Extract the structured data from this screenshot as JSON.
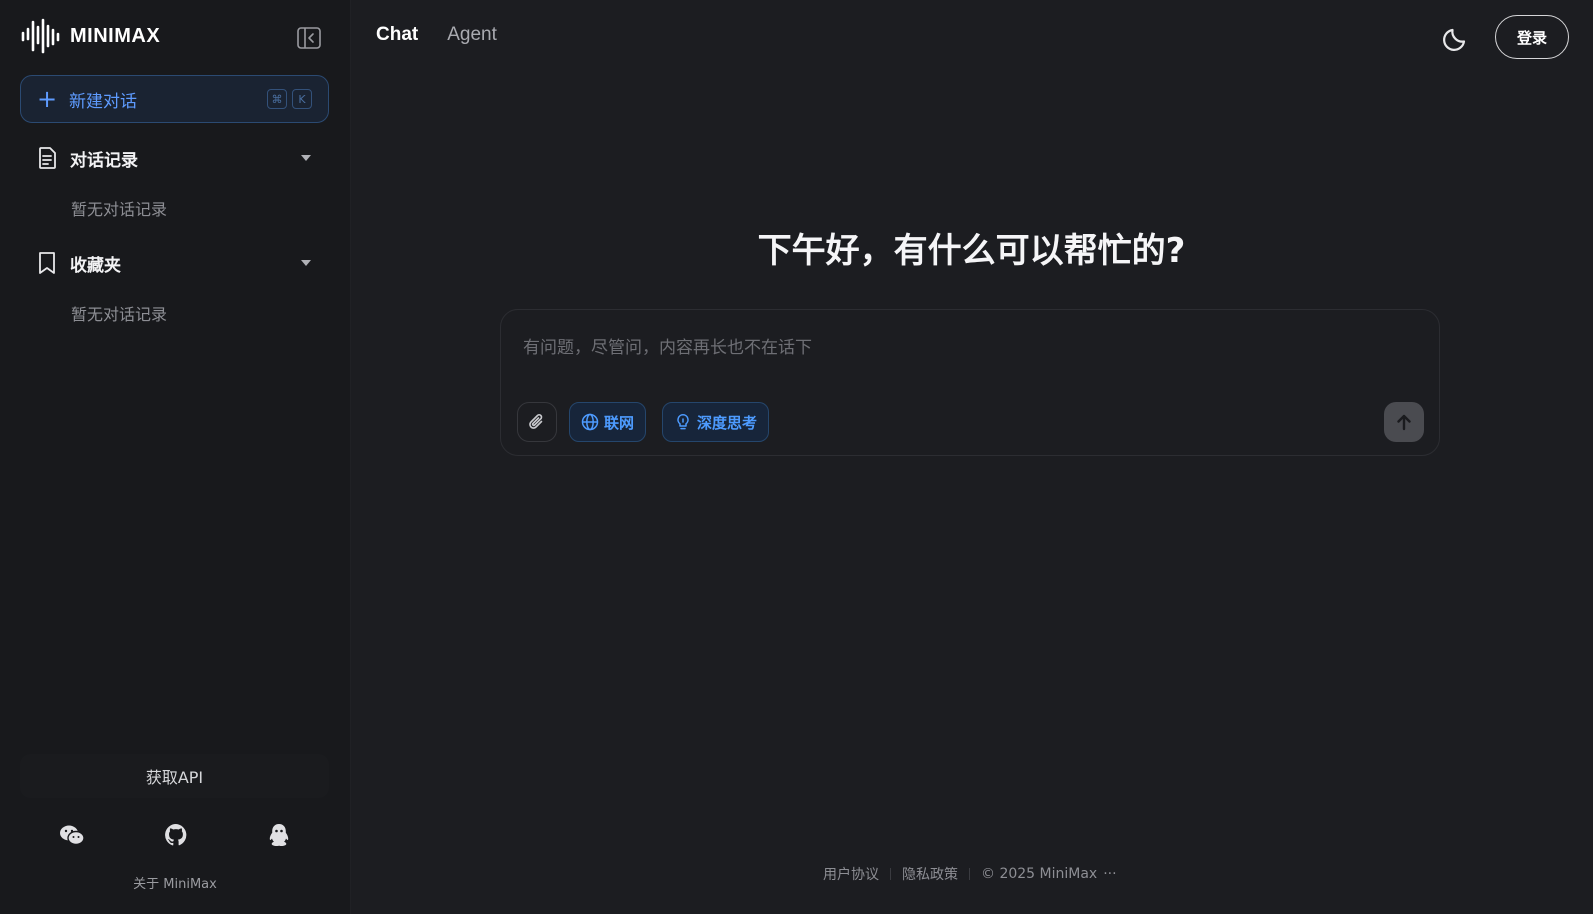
{
  "brand": {
    "name": "MINIMAX",
    "logo_icon": "waveform-logo"
  },
  "sidebar": {
    "collapse_icon": "sidebar-collapse-icon",
    "new_chat": {
      "label": "新建对话",
      "shortcut_keys": [
        "⌘",
        "K"
      ]
    },
    "history": {
      "title": "对话记录",
      "empty_text": "暂无对话记录"
    },
    "favorites": {
      "title": "收藏夹",
      "empty_text": "暂无对话记录"
    },
    "api_button": "获取API",
    "social_icons": [
      "wechat-icon",
      "github-icon",
      "qq-icon"
    ],
    "about_link": "关于 MiniMax"
  },
  "header": {
    "tabs": [
      {
        "label": "Chat",
        "active": true
      },
      {
        "label": "Agent",
        "active": false
      }
    ],
    "theme_icon": "moon-icon",
    "login_label": "登录"
  },
  "main": {
    "greeting": "下午好，有什么可以帮忙的?",
    "composer": {
      "placeholder": "有问题，尽管问，内容再长也不在话下",
      "chips": [
        {
          "label": "联网",
          "icon": "globe-icon"
        },
        {
          "label": "深度思考",
          "icon": "lightbulb-icon"
        }
      ],
      "attach_icon": "paperclip-icon",
      "send_icon": "arrow-up-icon"
    }
  },
  "footer": {
    "user_agreement": "用户协议",
    "privacy_policy": "隐私政策",
    "copyright": "© 2025 MiniMax",
    "more": "···"
  },
  "colors": {
    "background": "#1c1d21",
    "sidebar_bg": "#18191c",
    "accent_blue": "#4d9bff"
  }
}
